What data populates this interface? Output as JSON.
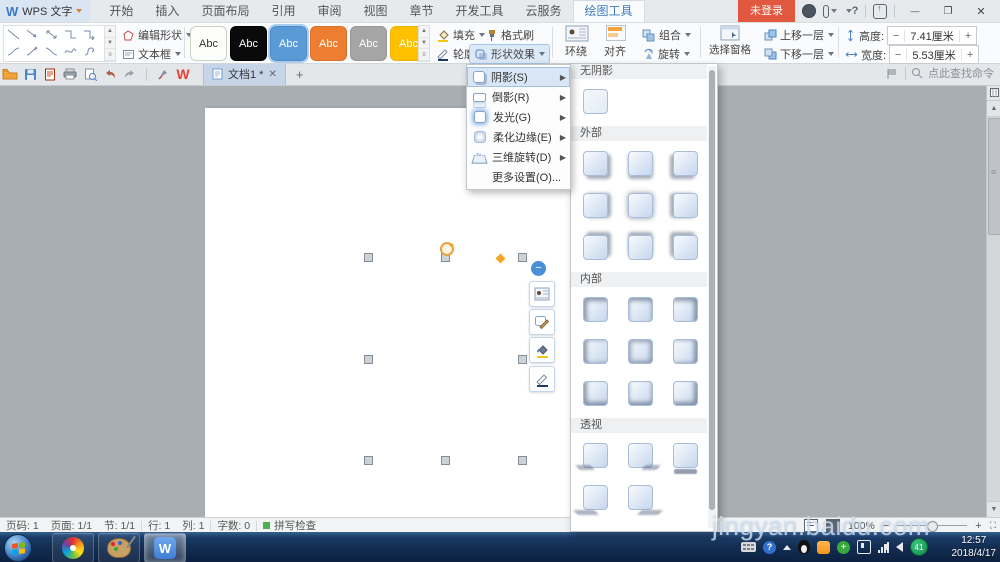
{
  "titlebar": {
    "app_name": "WPS 文字",
    "tabs": [
      "开始",
      "插入",
      "页面布局",
      "引用",
      "审阅",
      "视图",
      "章节",
      "开发工具",
      "云服务",
      "绘图工具"
    ],
    "login": "未登录"
  },
  "ribbon": {
    "edit_shape": "编辑形状",
    "text_box": "文本框",
    "styles": [
      "Abc",
      "Abc",
      "Abc",
      "Abc",
      "Abc",
      "Abc"
    ],
    "fill": "填充",
    "format_painter": "格式刷",
    "outline": "轮廓",
    "shape_effects": "形状效果",
    "wrap": "环绕",
    "align": "对齐",
    "group": "组合",
    "rotate": "旋转",
    "selection_pane": "选择窗格",
    "bring_forward": "上移一层",
    "send_backward": "下移一层",
    "height_label": "高度:",
    "height_value": "7.41厘米",
    "width_label": "宽度:",
    "width_value": "5.53厘米"
  },
  "docbar": {
    "doc_tab": "文档1 *",
    "find_hint": "点此查找命令"
  },
  "effects_menu": {
    "items": [
      "阴影(S)",
      "倒影(R)",
      "发光(G)",
      "柔化边缘(E)",
      "三维旋转(D)",
      "更多设置(O)..."
    ]
  },
  "shadow_gallery": {
    "sections": [
      {
        "label": "无阴影",
        "dirs": [
          "plain"
        ]
      },
      {
        "label": "外部",
        "dirs": [
          "out-br",
          "out-b",
          "out-bl",
          "out-r",
          "out-c",
          "out-l",
          "out-tr",
          "out-t",
          "out-tl"
        ]
      },
      {
        "label": "内部",
        "dirs": [
          "in-tl",
          "in-t",
          "in-tr",
          "in-l",
          "in-c",
          "in-r",
          "in-bl",
          "in-b",
          "in-br"
        ]
      },
      {
        "label": "透视",
        "dirs": [
          "p-bl",
          "p-br",
          "p-below",
          "p-left",
          "p-right"
        ]
      }
    ]
  },
  "statusbar": {
    "page_no": "页码: 1",
    "pages": "页面: 1/1",
    "section": "节: 1/1",
    "line": "行: 1",
    "col": "列: 1",
    "words": "字数: 0",
    "spell": "拼写检查",
    "zoom": "100%"
  },
  "taskbar": {
    "time": "12:57",
    "date": "2018/4/17",
    "badge": "41"
  },
  "watermark": "jingyan.baidu.com",
  "shape": {
    "fill": "#5B9BD5"
  },
  "colors": {
    "accent_blue": "#5B9BD5",
    "login_red": "#E2573F",
    "style_black": "#0A0A0A",
    "style_orange": "#ED7D31",
    "style_gray": "#A5A5A5",
    "style_gold": "#FFC000"
  }
}
